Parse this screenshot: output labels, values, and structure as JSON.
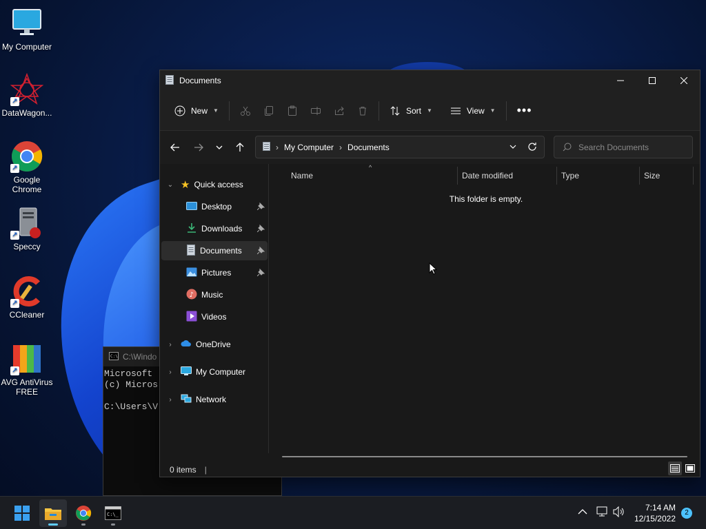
{
  "desktop": {
    "icons": [
      {
        "label": "My Computer",
        "icon": "monitor-icon"
      },
      {
        "label": "DataWagon...",
        "icon": "datawagon-icon"
      },
      {
        "label": "Google Chrome",
        "icon": "chrome-icon"
      },
      {
        "label": "Speccy",
        "icon": "speccy-icon"
      },
      {
        "label": "CCleaner",
        "icon": "ccleaner-icon"
      },
      {
        "label": "AVG AntiVirus FREE",
        "icon": "avg-icon"
      }
    ]
  },
  "cmd": {
    "title": "C:\\Windo",
    "lines": [
      "Microsoft ",
      "(c) Micros",
      "",
      "C:\\Users\\V"
    ]
  },
  "explorer": {
    "title": "Documents",
    "toolbar": {
      "new_label": "New",
      "sort_label": "Sort",
      "view_label": "View"
    },
    "address": {
      "crumbs": [
        "My Computer",
        "Documents"
      ]
    },
    "search": {
      "placeholder": "Search Documents"
    },
    "sidebar": {
      "quick_access": "Quick access",
      "items": [
        {
          "label": "Desktop",
          "icon": "desktop-icon",
          "pinned": true
        },
        {
          "label": "Downloads",
          "icon": "downloads-icon",
          "pinned": true
        },
        {
          "label": "Documents",
          "icon": "documents-icon",
          "pinned": true
        },
        {
          "label": "Pictures",
          "icon": "pictures-icon",
          "pinned": true
        },
        {
          "label": "Music",
          "icon": "music-icon",
          "pinned": false
        },
        {
          "label": "Videos",
          "icon": "videos-icon",
          "pinned": false
        }
      ],
      "roots": [
        {
          "label": "OneDrive",
          "icon": "onedrive-icon"
        },
        {
          "label": "My Computer",
          "icon": "computer-icon"
        },
        {
          "label": "Network",
          "icon": "network-icon"
        }
      ]
    },
    "columns": [
      "Name",
      "Date modified",
      "Type",
      "Size"
    ],
    "empty_message": "This folder is empty.",
    "status": {
      "items_count": "0 items"
    }
  },
  "taskbar": {
    "time": "7:14 AM",
    "date": "12/15/2022",
    "notification_count": "2"
  },
  "colors": {
    "accent": "#60cdff",
    "window_bg": "#191919",
    "titlebar_bg": "#202020",
    "taskbar_bg": "#1b1d22"
  }
}
